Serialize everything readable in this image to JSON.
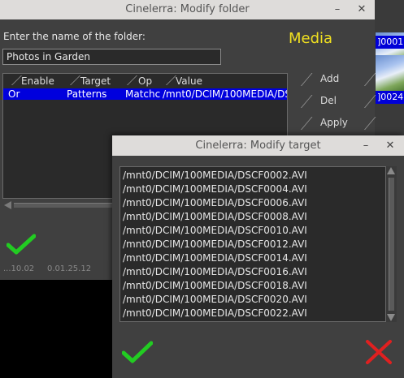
{
  "background": {
    "thumbnails": [
      {
        "label": "]0001",
        "label_color": "#0000d8"
      },
      {
        "label": "]0024.",
        "label_color": "#0000d8"
      }
    ],
    "timecodes": [
      "...10.02",
      "0.01.25.12"
    ]
  },
  "folder_window": {
    "title": "Cinelerra: Modify folder",
    "minimize_glyph": "–",
    "close_glyph": "✕",
    "name_prompt": "Enter the name of the folder:",
    "media_label": "Media",
    "media_color": "#f0e020",
    "folder_name": "Photos in Garden",
    "columns": [
      "Enable",
      "Target",
      "Op",
      "Value"
    ],
    "rows": [
      {
        "enable": "Or",
        "target": "Patterns",
        "op": "Matchc",
        "value": "/mnt0/DCIM/100MEDIA/DS"
      }
    ],
    "buttons": {
      "add": "Add",
      "del": "Del",
      "apply": "Apply"
    },
    "ok_icon": "checkmark-icon"
  },
  "target_window": {
    "title": "Cinelerra: Modify target",
    "minimize_glyph": "–",
    "close_glyph": "✕",
    "items": [
      "/mnt0/DCIM/100MEDIA/DSCF0002.AVI",
      "/mnt0/DCIM/100MEDIA/DSCF0004.AVI",
      "/mnt0/DCIM/100MEDIA/DSCF0006.AVI",
      "/mnt0/DCIM/100MEDIA/DSCF0008.AVI",
      "/mnt0/DCIM/100MEDIA/DSCF0010.AVI",
      "/mnt0/DCIM/100MEDIA/DSCF0012.AVI",
      "/mnt0/DCIM/100MEDIA/DSCF0014.AVI",
      "/mnt0/DCIM/100MEDIA/DSCF0016.AVI",
      "/mnt0/DCIM/100MEDIA/DSCF0018.AVI",
      "/mnt0/DCIM/100MEDIA/DSCF0020.AVI",
      "/mnt0/DCIM/100MEDIA/DSCF0022.AVI"
    ],
    "ok_icon": "checkmark-icon",
    "cancel_icon": "red-x-icon",
    "ok_color": "#22cc22",
    "cancel_color": "#e02020"
  }
}
